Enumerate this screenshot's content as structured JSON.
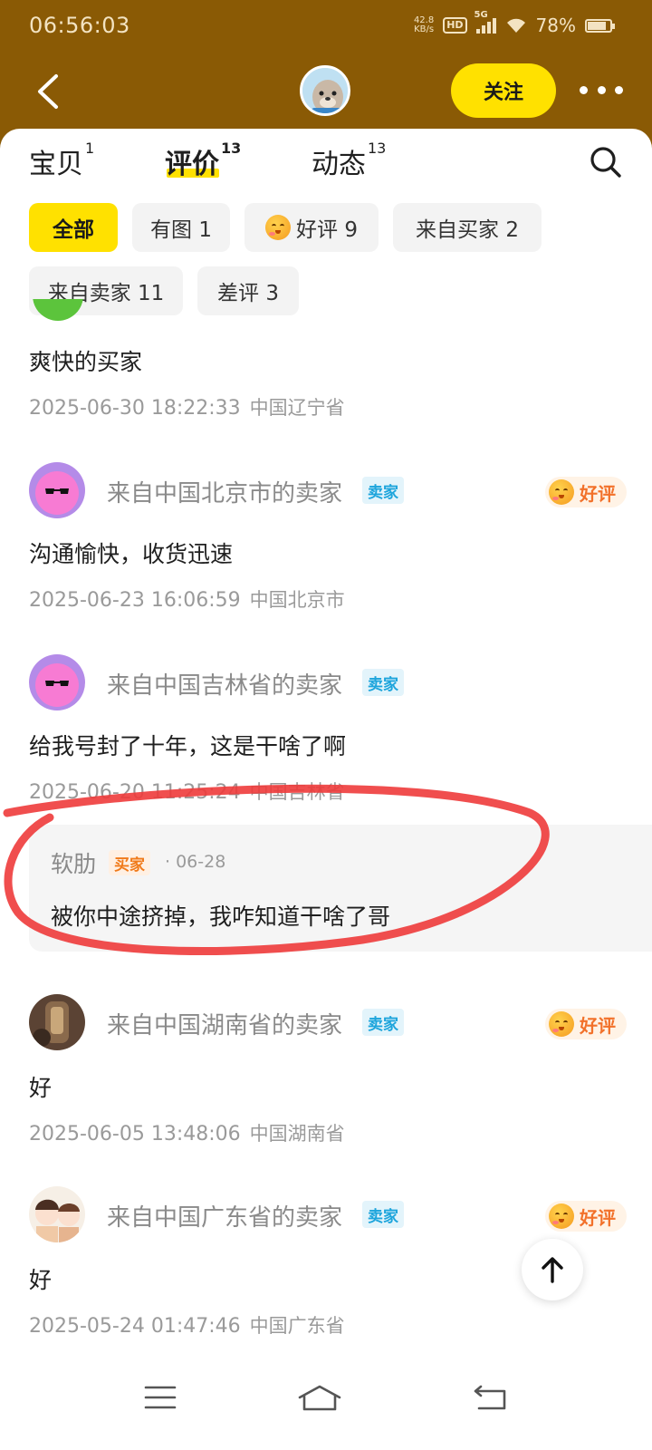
{
  "status_bar": {
    "time": "06:56:03",
    "net_speed_value": "42.8",
    "net_speed_unit": "KB/s",
    "hd": "HD",
    "network": "5G",
    "battery": "78%"
  },
  "header": {
    "follow_label": "关注"
  },
  "tabs": [
    {
      "label": "宝贝",
      "count": "1"
    },
    {
      "label": "评价",
      "count": "13"
    },
    {
      "label": "动态",
      "count": "13"
    }
  ],
  "filters": [
    {
      "label": "全部"
    },
    {
      "label": "有图 1"
    },
    {
      "label": "好评 9"
    },
    {
      "label": "来自买家 2"
    },
    {
      "label": "来自卖家 11"
    },
    {
      "label": "差评 3"
    }
  ],
  "reviews": [
    {
      "text": "爽快的买家",
      "date": "2025-06-30 18:22:33",
      "location": "中国辽宁省"
    },
    {
      "name": "来自中国北京市的卖家",
      "role": "卖家",
      "rating": "好评",
      "text": "沟通愉快，收货迅速",
      "date": "2025-06-23 16:06:59",
      "location": "中国北京市"
    },
    {
      "name": "来自中国吉林省的卖家",
      "role": "卖家",
      "text": "给我号封了十年，这是干啥了啊",
      "date": "2025-06-20 11:25:24",
      "location": "中国吉林省",
      "reply": {
        "name": "软肋",
        "role": "买家",
        "date": "· 06-28",
        "text": "被你中途挤掉，我咋知道干啥了哥"
      }
    },
    {
      "name": "来自中国湖南省的卖家",
      "role": "卖家",
      "rating": "好评",
      "text": "好",
      "date": "2025-06-05 13:48:06",
      "location": "中国湖南省"
    },
    {
      "name": "来自中国广东省的卖家",
      "role": "卖家",
      "rating": "好评",
      "text": "好",
      "date": "2025-05-24 01:47:46",
      "location": "中国广东省"
    }
  ],
  "colors": {
    "header_bg": "#8a5a05",
    "accent_yellow": "#ffe100",
    "seller_badge": "#1ea5dc",
    "buyer_badge": "#f07a1a",
    "rating_text": "#f2712a",
    "annotation_circle": "#ee3b3b"
  }
}
